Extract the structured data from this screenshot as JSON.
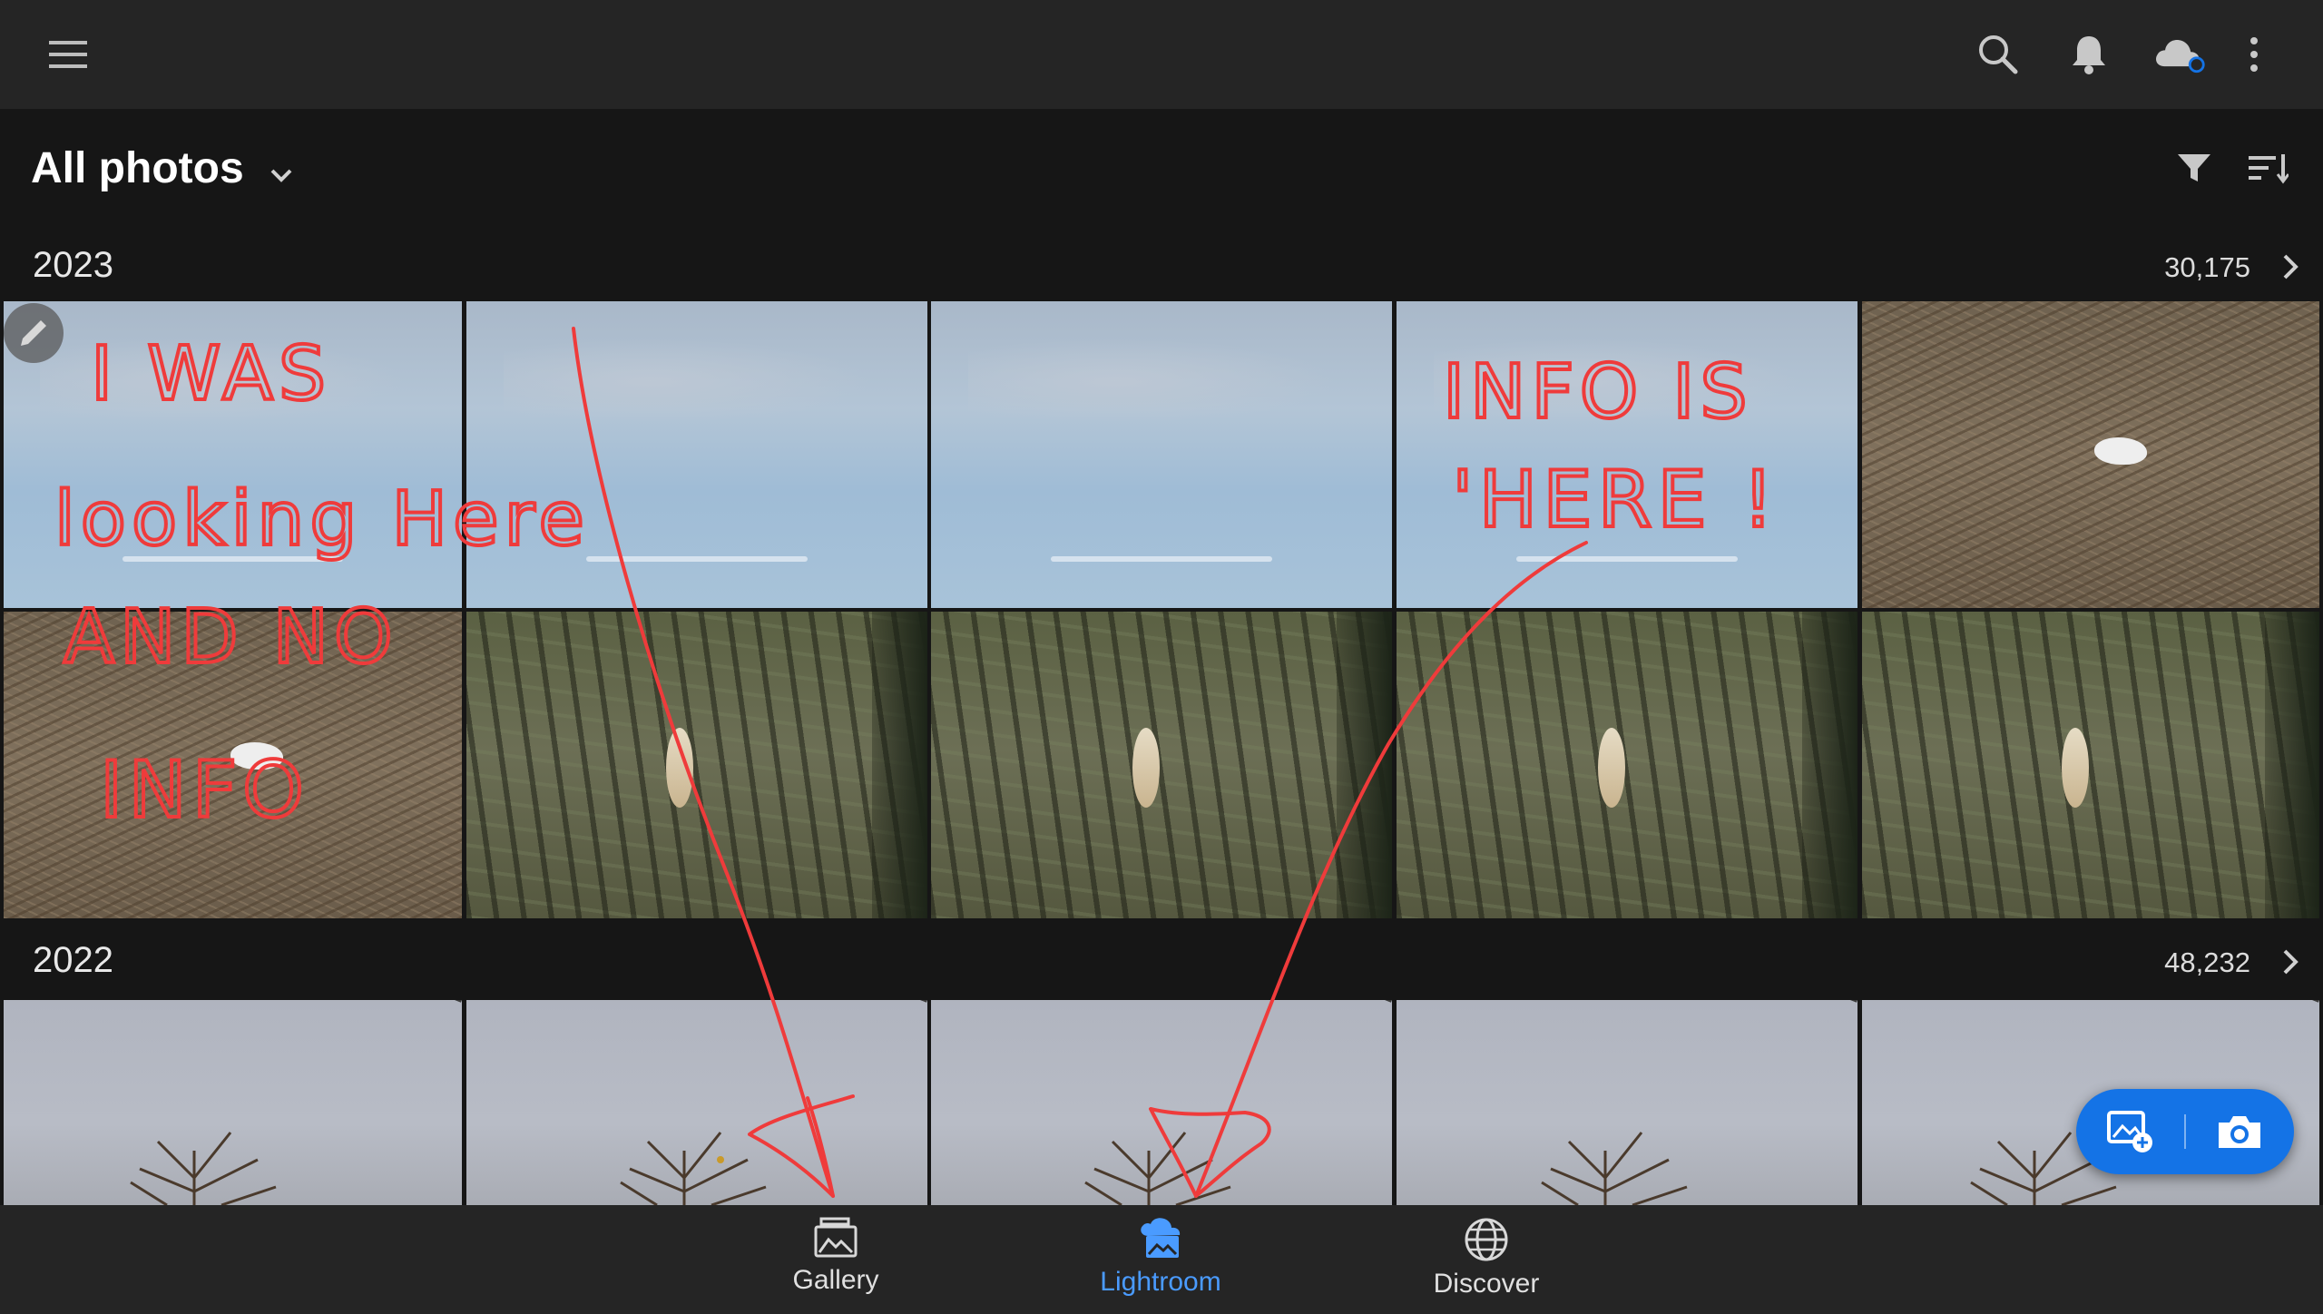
{
  "topbar": {
    "menu_icon": "hamburger-menu-icon",
    "search_icon": "search-icon",
    "notifications_icon": "bell-icon",
    "cloud_icon": "cloud-sync-icon",
    "more_icon": "more-vertical-icon"
  },
  "header": {
    "title": "All photos",
    "filter_icon": "filter-icon",
    "sort_icon": "sort-icon"
  },
  "sections": [
    {
      "year": "2023",
      "count": "30,175"
    },
    {
      "year": "2022",
      "count": "48,232"
    }
  ],
  "annotations": {
    "left_note_lines": [
      "I WAS",
      "looking Here",
      "AND NO",
      "INFO"
    ],
    "right_note_lines": [
      "INFO IS",
      "'HERE !"
    ],
    "color": "#ef3b3b"
  },
  "fab": {
    "add_photo_icon": "add-photo-icon",
    "camera_icon": "camera-icon"
  },
  "bottom_nav": {
    "items": [
      {
        "label": "Gallery",
        "icon": "gallery-icon"
      },
      {
        "label": "Lightroom",
        "icon": "lightroom-cloud-icon",
        "active": true
      },
      {
        "label": "Discover",
        "icon": "globe-icon"
      }
    ]
  },
  "colors": {
    "accent": "#1473e6",
    "active_nav": "#4a9bff",
    "bar_bg": "#252525",
    "page_bg": "#161616"
  }
}
